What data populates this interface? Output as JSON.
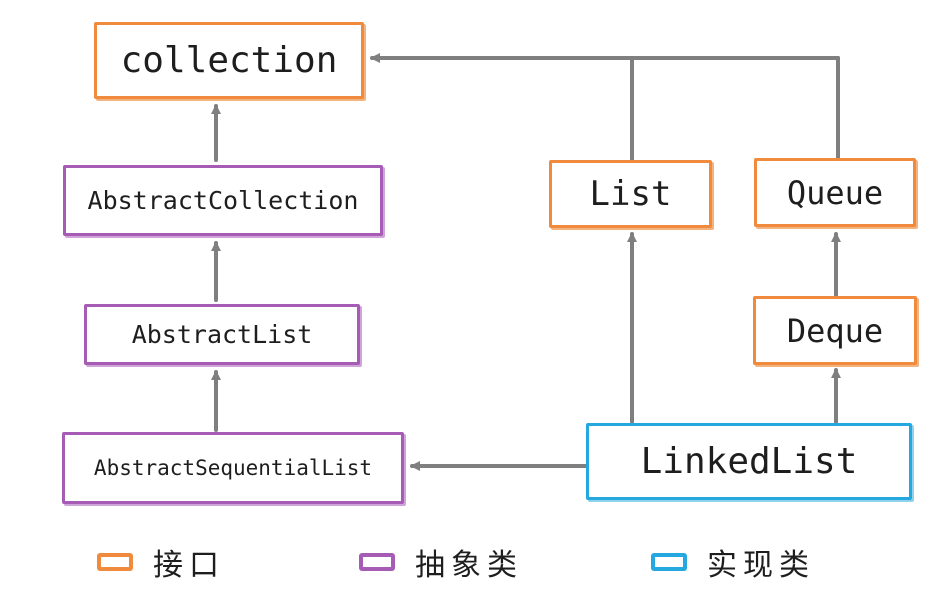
{
  "nodes": {
    "collection": "collection",
    "abstract_collection": "AbstractCollection",
    "abstract_list": "AbstractList",
    "abstract_sequential_list": "AbstractSequentialList",
    "list": "List",
    "queue": "Queue",
    "deque": "Deque",
    "linked_list": "LinkedList"
  },
  "legend": {
    "interface": "接口",
    "abstract_class": "抽象类",
    "implementation_class": "实现类"
  },
  "colors": {
    "interface": "#f08a3c",
    "abstract_class": "#a65bb4",
    "implementation_class": "#25a8e0",
    "arrow": "#7f7f7f"
  }
}
